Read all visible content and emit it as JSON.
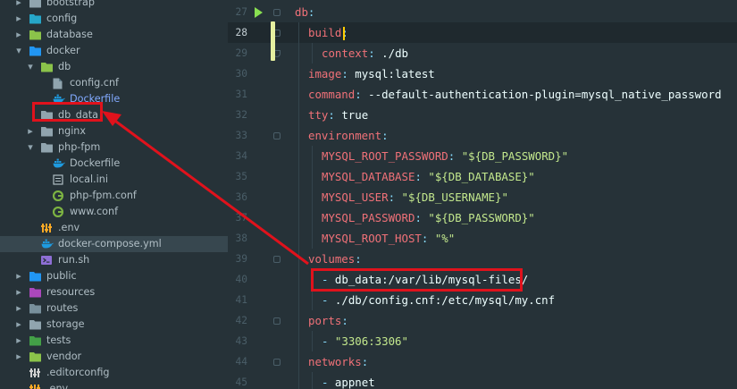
{
  "project_tree": {
    "items": [
      {
        "label": "bootstrap",
        "icon": "folder-icon",
        "chevron": "right"
      },
      {
        "label": "config",
        "icon": "folder-config-icon",
        "chevron": "right"
      },
      {
        "label": "database",
        "icon": "folder-database-icon",
        "chevron": "right"
      },
      {
        "label": "docker",
        "icon": "folder-docker-icon",
        "chevron": "down"
      },
      {
        "label": "db",
        "icon": "folder-db-icon",
        "chevron": "down"
      },
      {
        "label": "config.cnf",
        "icon": "file-icon"
      },
      {
        "label": "Dockerfile",
        "icon": "docker-icon"
      },
      {
        "label": "db_data",
        "icon": "folder-icon"
      },
      {
        "label": "nginx",
        "icon": "folder-icon",
        "chevron": "right"
      },
      {
        "label": "php-fpm",
        "icon": "folder-icon",
        "chevron": "down"
      },
      {
        "label": "Dockerfile",
        "icon": "docker-icon"
      },
      {
        "label": "local.ini",
        "icon": "ini-icon"
      },
      {
        "label": "php-fpm.conf",
        "icon": "conf-icon"
      },
      {
        "label": "www.conf",
        "icon": "conf-icon"
      },
      {
        "label": ".env",
        "icon": "env-icon"
      },
      {
        "label": "docker-compose.yml",
        "icon": "docker-icon",
        "selected": true
      },
      {
        "label": "run.sh",
        "icon": "shell-icon"
      },
      {
        "label": "public",
        "icon": "folder-public-icon",
        "chevron": "right"
      },
      {
        "label": "resources",
        "icon": "folder-resources-icon",
        "chevron": "right"
      },
      {
        "label": "routes",
        "icon": "folder-routes-icon",
        "chevron": "right"
      },
      {
        "label": "storage",
        "icon": "folder-icon",
        "chevron": "right"
      },
      {
        "label": "tests",
        "icon": "folder-tests-icon",
        "chevron": "right"
      },
      {
        "label": "vendor",
        "icon": "folder-vendor-icon",
        "chevron": "right"
      },
      {
        "label": ".editorconfig",
        "icon": "editorconfig-icon"
      },
      {
        "label": ".env",
        "icon": "env-icon"
      }
    ]
  },
  "editor": {
    "lines": [
      {
        "num": "27",
        "key": "db",
        "value": ""
      },
      {
        "num": "28",
        "key": "build",
        "value": ""
      },
      {
        "num": "29",
        "key": "context",
        "value": "./db"
      },
      {
        "num": "30",
        "key": "image",
        "value": "mysql:latest"
      },
      {
        "num": "31",
        "key": "command",
        "value": "--default-authentication-plugin=mysql_native_password"
      },
      {
        "num": "32",
        "key": "tty",
        "value": "true"
      },
      {
        "num": "33",
        "key": "environment",
        "value": ""
      },
      {
        "num": "34",
        "key": "MYSQL_ROOT_PASSWORD",
        "value": "\"${DB_PASSWORD}\""
      },
      {
        "num": "35",
        "key": "MYSQL_DATABASE",
        "value": "\"${DB_DATABASE}\""
      },
      {
        "num": "36",
        "key": "MYSQL_USER",
        "value": "\"${DB_USERNAME}\""
      },
      {
        "num": "37",
        "key": "MYSQL_PASSWORD",
        "value": "\"${DB_PASSWORD}\""
      },
      {
        "num": "38",
        "key": "MYSQL_ROOT_HOST",
        "value": "\"%\""
      },
      {
        "num": "39",
        "key": "volumes",
        "value": ""
      },
      {
        "num": "40",
        "item": "db_data:/var/lib/mysql-files/"
      },
      {
        "num": "41",
        "item": "./db/config.cnf:/etc/mysql/my.cnf"
      },
      {
        "num": "42",
        "key": "ports",
        "value": ""
      },
      {
        "num": "43",
        "item": "\"3306:3306\""
      },
      {
        "num": "44",
        "key": "networks",
        "value": ""
      },
      {
        "num": "45",
        "item": "appnet"
      }
    ]
  },
  "colors": {
    "background": "#263238",
    "key": "#f07178",
    "string": "#c3e88d",
    "highlight": "#e0121c",
    "cursor": "#ffcc00"
  }
}
